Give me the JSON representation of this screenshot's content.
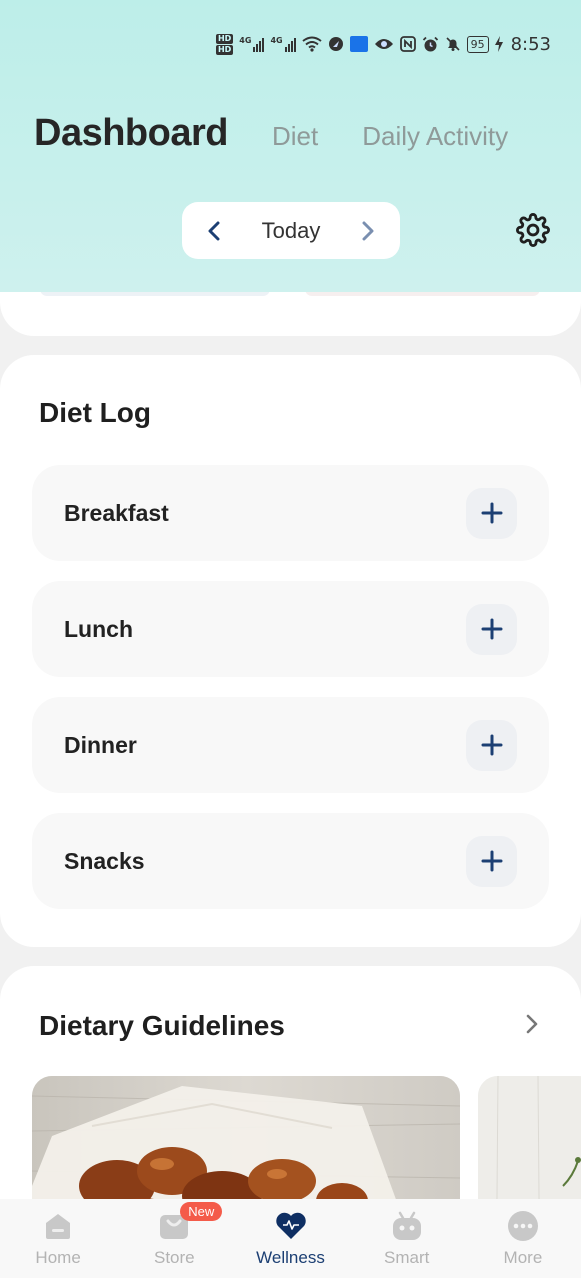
{
  "status_bar": {
    "time": "8:53",
    "battery": "95",
    "network_1": "4G",
    "network_2": "4G",
    "hd_1": "HD",
    "hd_2": "HD"
  },
  "header": {
    "tabs": [
      {
        "label": "Dashboard"
      },
      {
        "label": "Diet"
      },
      {
        "label": "Daily Activity"
      }
    ],
    "date_label": "Today"
  },
  "diet_log": {
    "title": "Diet Log",
    "meals": [
      {
        "label": "Breakfast"
      },
      {
        "label": "Lunch"
      },
      {
        "label": "Dinner"
      },
      {
        "label": "Snacks"
      }
    ]
  },
  "guidelines": {
    "title": "Dietary Guidelines"
  },
  "bottom_nav": {
    "items": [
      {
        "label": "Home"
      },
      {
        "label": "Store",
        "badge": "New"
      },
      {
        "label": "Wellness"
      },
      {
        "label": "Smart"
      },
      {
        "label": "More"
      }
    ],
    "active": "Wellness"
  },
  "colors": {
    "header_bg": "#c7f0ec",
    "accent_dark_blue": "#1c3f73",
    "badge_red": "#f45b4a"
  }
}
